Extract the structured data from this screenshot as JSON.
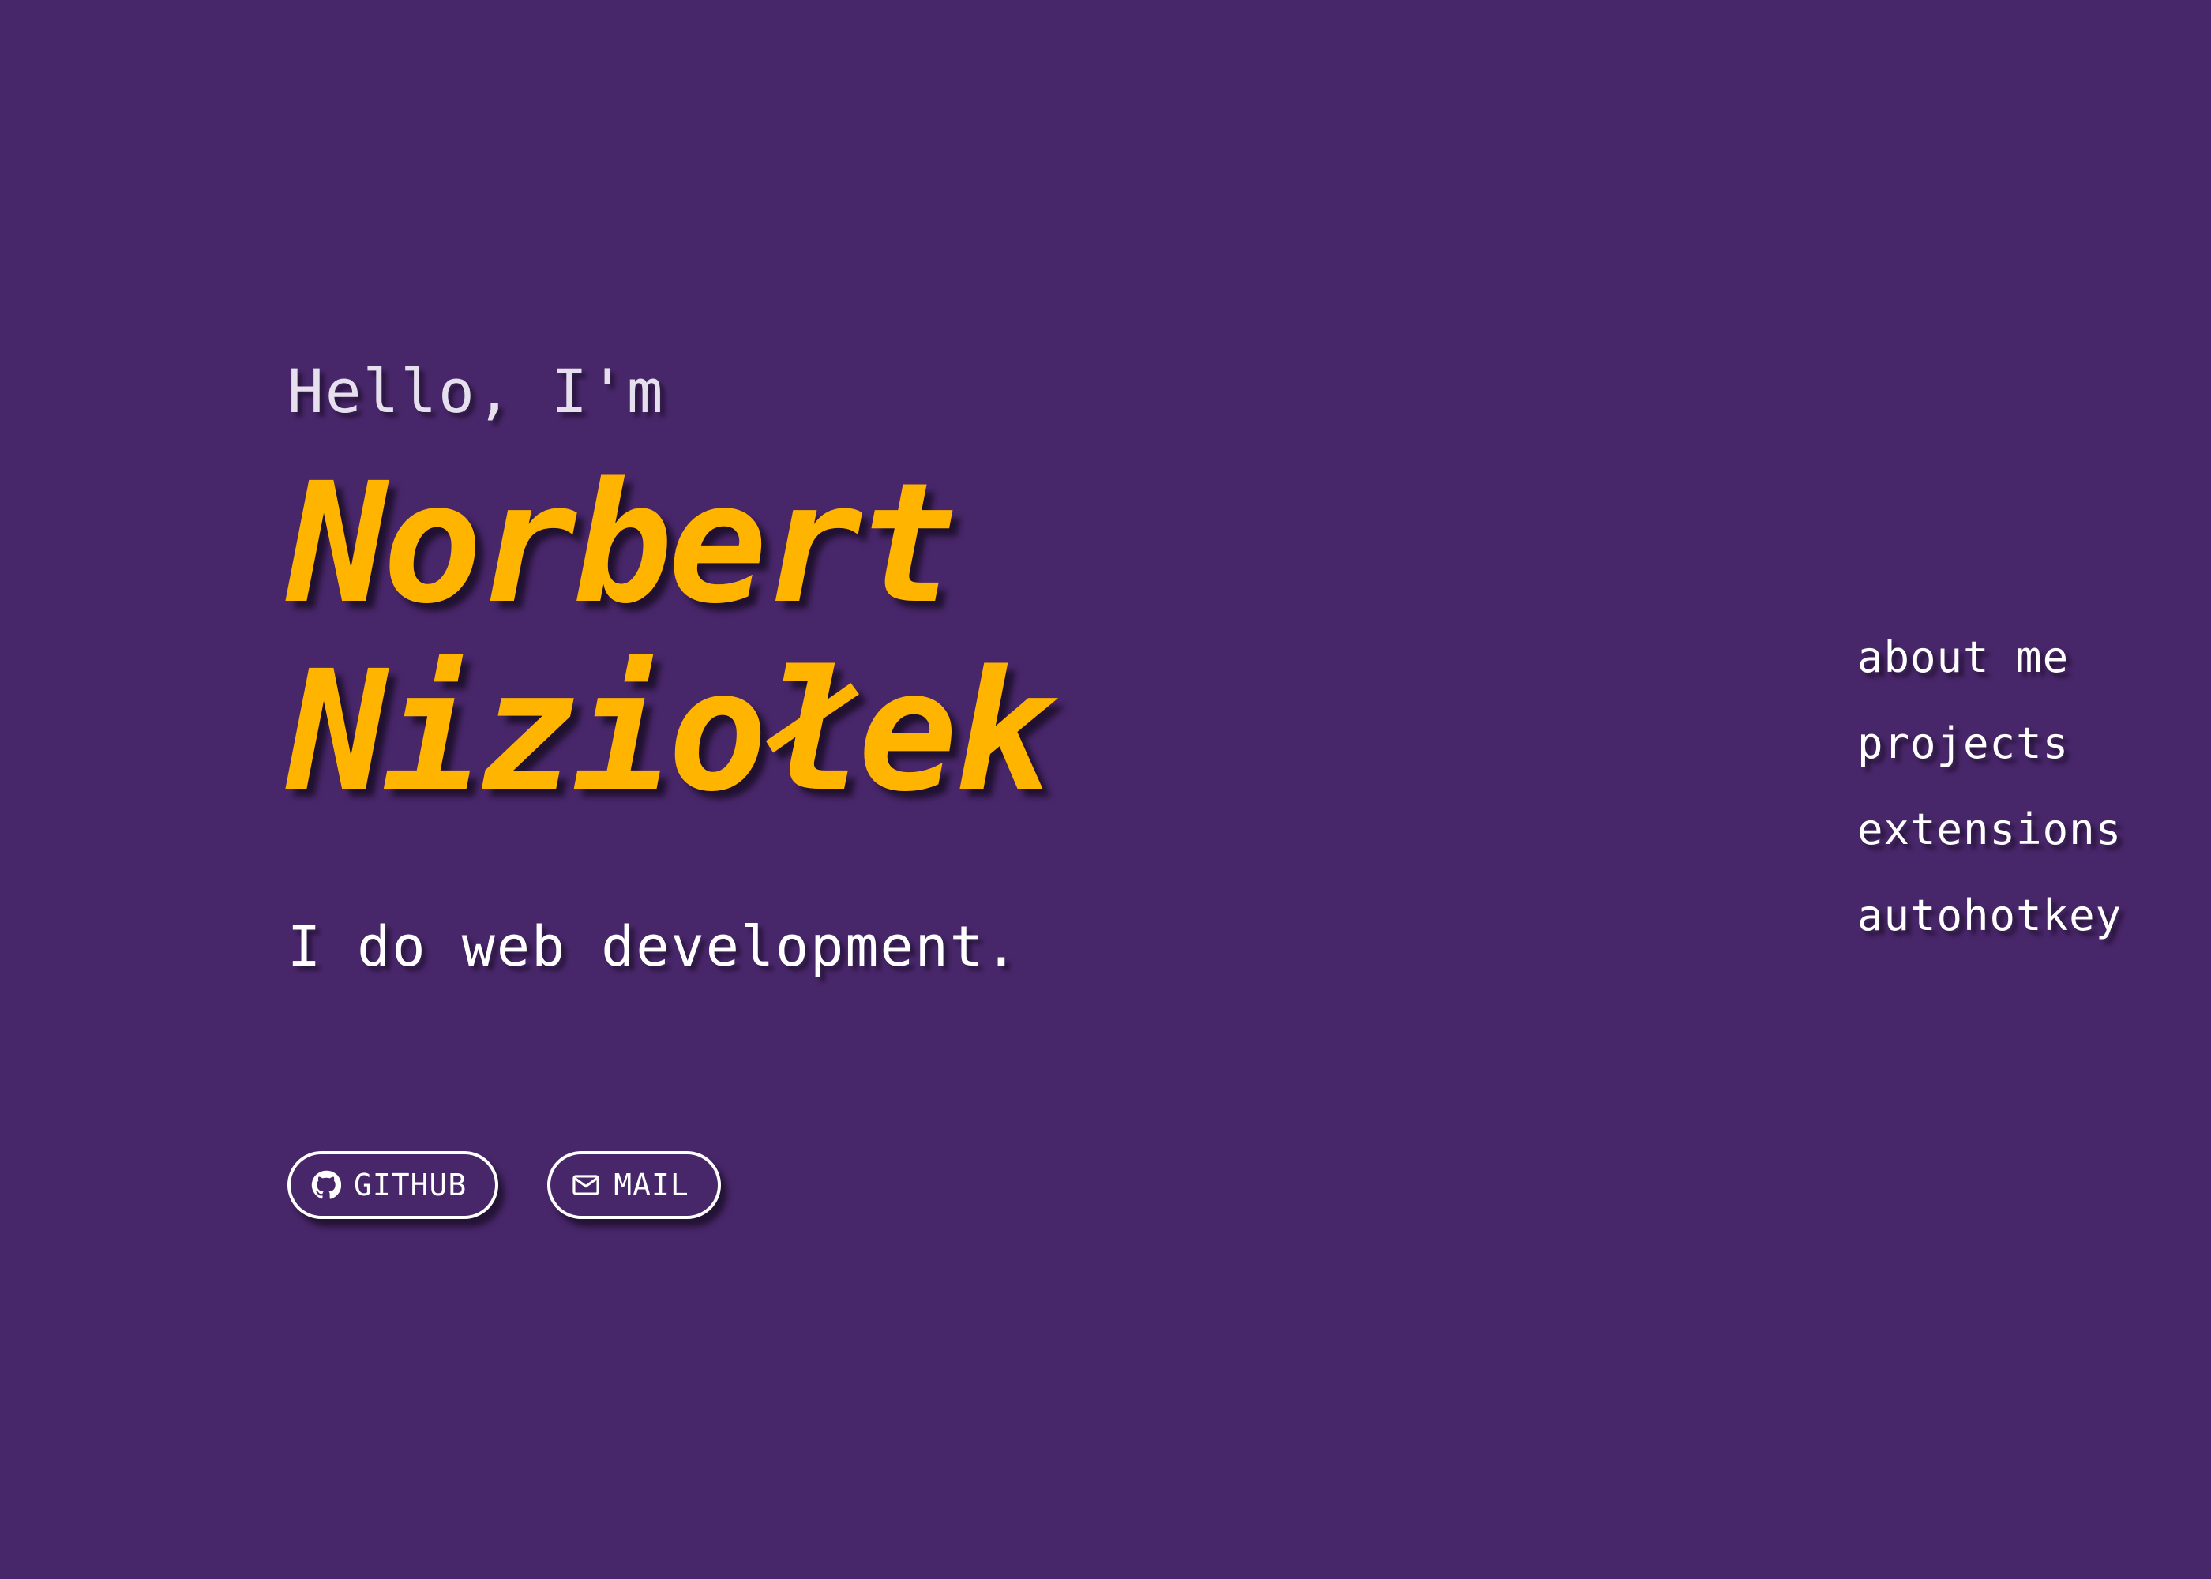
{
  "hero": {
    "greeting": "Hello, I'm",
    "name_line1": "Norbert",
    "name_line2": "Niziołek",
    "tagline": "I do web development."
  },
  "buttons": {
    "github": {
      "label": "GITHUB",
      "icon": "github-icon"
    },
    "mail": {
      "label": "MAIL",
      "icon": "mail-icon"
    }
  },
  "nav": {
    "items": [
      {
        "label": "about me"
      },
      {
        "label": "projects"
      },
      {
        "label": "extensions"
      },
      {
        "label": "autohotkey"
      }
    ]
  },
  "colors": {
    "background": "#48266a",
    "accent": "#ffb400",
    "text": "#ffffff"
  }
}
